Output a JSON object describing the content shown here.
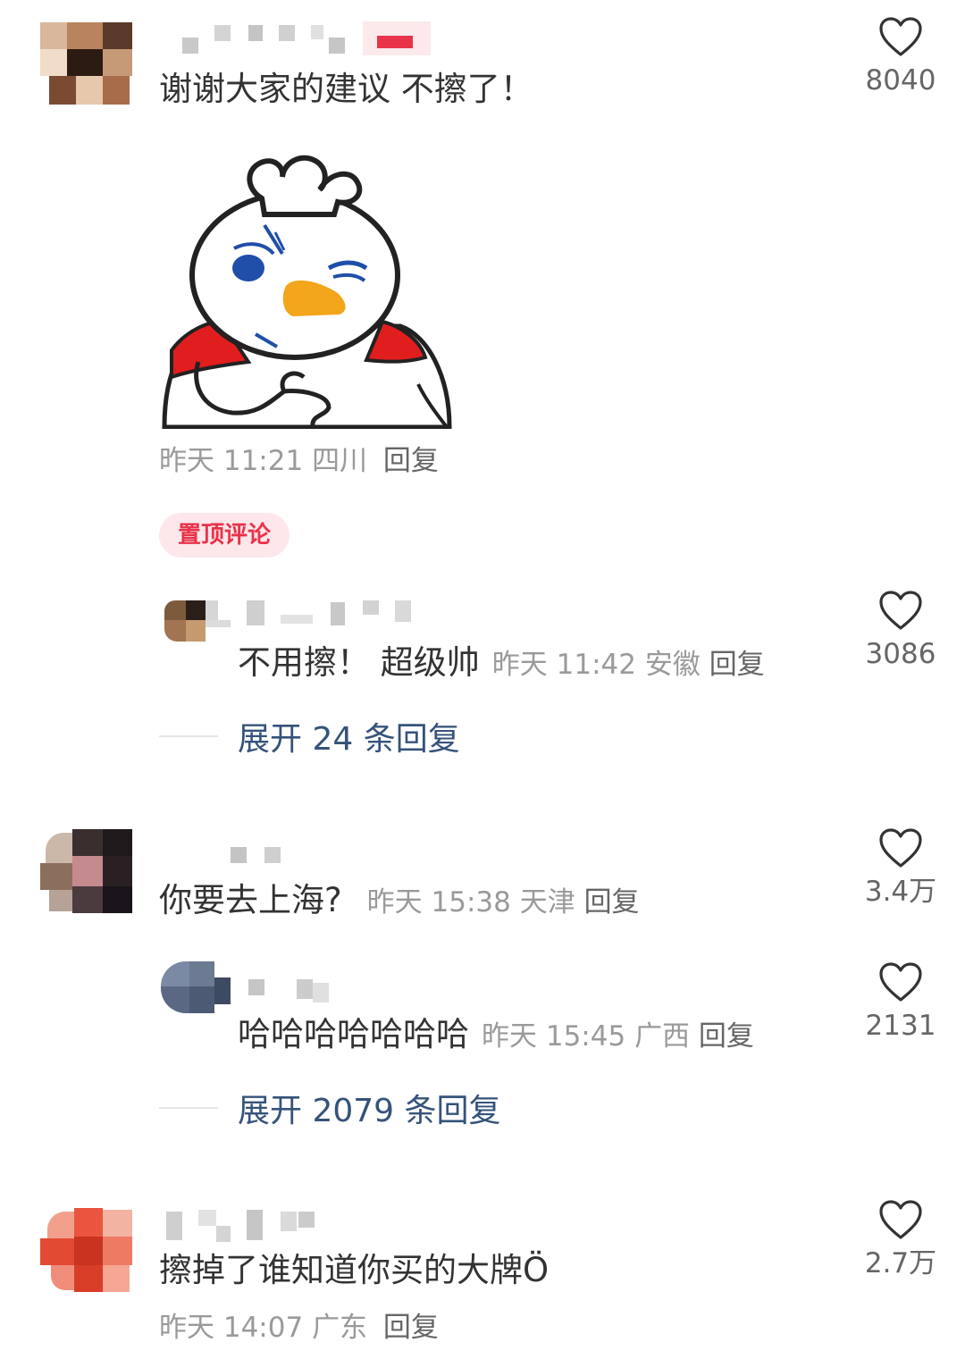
{
  "comments": [
    {
      "text": "谢谢大家的建议 不擦了！",
      "time": "昨天 11:21",
      "location": "四川",
      "reply_label": "回复",
      "likes": "8040",
      "badge": "置顶评论",
      "replies": [
        {
          "text": "不用擦！ 超级帅",
          "time": "昨天 11:42",
          "location": "安徽",
          "reply_label": "回复",
          "likes": "3086"
        }
      ],
      "expand_label": "展开 24 条回复"
    },
    {
      "text": "你要去上海?",
      "time": "昨天 15:38",
      "location": "天津",
      "reply_label": "回复",
      "likes": "3.4万",
      "replies": [
        {
          "text": "哈哈哈哈哈哈哈",
          "time": "昨天 15:45",
          "location": "广西",
          "reply_label": "回复",
          "likes": "2131"
        }
      ],
      "expand_label": "展开 2079 条回复"
    },
    {
      "text": "擦掉了谁知道你买的大牌Ö",
      "time": "昨天 14:07",
      "location": "广东",
      "reply_label": "回复",
      "likes": "2.7万"
    }
  ],
  "icons": {
    "like": "heart-outline-icon",
    "sticker": "duck-king-sticker"
  },
  "colors": {
    "accent_red": "#e8334a",
    "link_blue": "#35537a",
    "meta_gray": "#9a9a9a"
  }
}
